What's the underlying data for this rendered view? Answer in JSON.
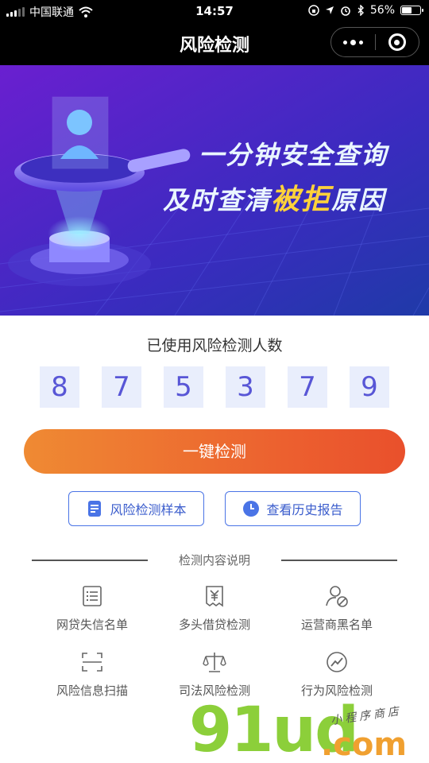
{
  "status_bar": {
    "carrier": "中国联通",
    "time": "14:57",
    "battery": "56%",
    "battery_level": 0.56,
    "icons": [
      "signal-icon",
      "wifi-icon",
      "lock-rotation-icon",
      "location-icon",
      "alarm-icon",
      "bluetooth-icon",
      "battery-icon"
    ]
  },
  "nav": {
    "title": "风险检测",
    "more_icon": "more-icon",
    "close_icon": "close-icon"
  },
  "banner": {
    "line1": "一分钟安全查询",
    "line2_a": "及时查清",
    "line2_highlight": "被拒",
    "line2_b": "原因",
    "colors": {
      "bg_start": "#6a1fd0",
      "bg_end": "#2a3ab8",
      "text": "#ffffff",
      "highlight": "#ffd23a"
    }
  },
  "counter": {
    "title": "已使用风险检测人数",
    "digits": [
      "8",
      "7",
      "5",
      "3",
      "7",
      "9"
    ]
  },
  "actions": {
    "main_label": "一键检测",
    "sample_label": "风险检测样本",
    "sample_icon": "document-icon",
    "history_label": "查看历史报告",
    "history_icon": "clock-icon"
  },
  "section": {
    "title": "检测内容说明"
  },
  "features": [
    {
      "label": "网贷失信名单",
      "icon": "list-icon"
    },
    {
      "label": "多头借贷检测",
      "icon": "yuan-receipt-icon"
    },
    {
      "label": "运营商黑名单",
      "icon": "user-blocked-icon"
    },
    {
      "label": "风险信息扫描",
      "icon": "scan-icon"
    },
    {
      "label": "司法风险检测",
      "icon": "scale-icon"
    },
    {
      "label": "行为风险检测",
      "icon": "trend-icon"
    }
  ],
  "watermark": {
    "text": "91ud",
    "domain": ".com",
    "tagline": "小程序商店"
  },
  "colors": {
    "accent": "#4a74e6",
    "button_start": "#ef8a33",
    "button_end": "#e9502c",
    "digit_bg": "#e9eefc",
    "digit_fg": "#5856d6"
  }
}
